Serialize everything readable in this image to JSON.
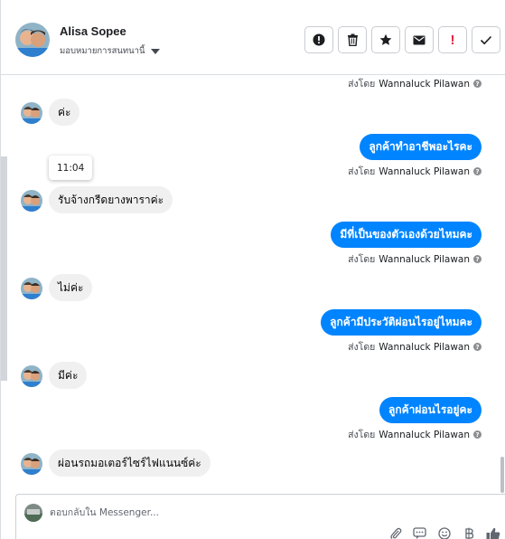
{
  "header": {
    "contact_name": "Alisa Sopee",
    "assign_label": "มอบหมายการสนทนานี้",
    "actions": [
      {
        "name": "mark-spam-button",
        "icon": "alert-circle-icon"
      },
      {
        "name": "delete-button",
        "icon": "trash-icon"
      },
      {
        "name": "star-button",
        "icon": "star-icon"
      },
      {
        "name": "mark-unread-button",
        "icon": "envelope-icon"
      },
      {
        "name": "follow-up-button",
        "icon": "exclamation-icon"
      },
      {
        "name": "mark-done-button",
        "icon": "check-icon"
      }
    ]
  },
  "thread": {
    "sent_by_prefix": "ส่งโดย",
    "sender_name": "Wannaluck Pilawan",
    "tooltip_time": "11:04",
    "messages": [
      {
        "side": "in",
        "text": "ค่ะ"
      },
      {
        "side": "out",
        "text": "ลูกค้าทำอาชีพอะไรคะ"
      },
      {
        "side": "in",
        "text": "รับจ้างกรีดยางพาราค่ะ"
      },
      {
        "side": "out",
        "text": "มีที่เป็นของตัวเองด้วยไหมคะ"
      },
      {
        "side": "in",
        "text": "ไม่ค่ะ"
      },
      {
        "side": "out",
        "text": "ลูกค้ามีประวัติผ่อนไรอยู่ไหมคะ"
      },
      {
        "side": "in",
        "text": "มีค่ะ"
      },
      {
        "side": "out",
        "text": "ลูกค้าผ่อนไรอยู่คะ"
      },
      {
        "side": "in",
        "text": "ผ่อนรถมอเตอร์ไซร์ไฟแนนซ์ค่ะ"
      }
    ]
  },
  "composer": {
    "placeholder": "ตอบกลับใน Messenger..."
  },
  "colors": {
    "outgoing_bubble": "#0084ff",
    "incoming_bubble": "#f0f0f0",
    "follow_up_accent": "#e41e3f"
  }
}
